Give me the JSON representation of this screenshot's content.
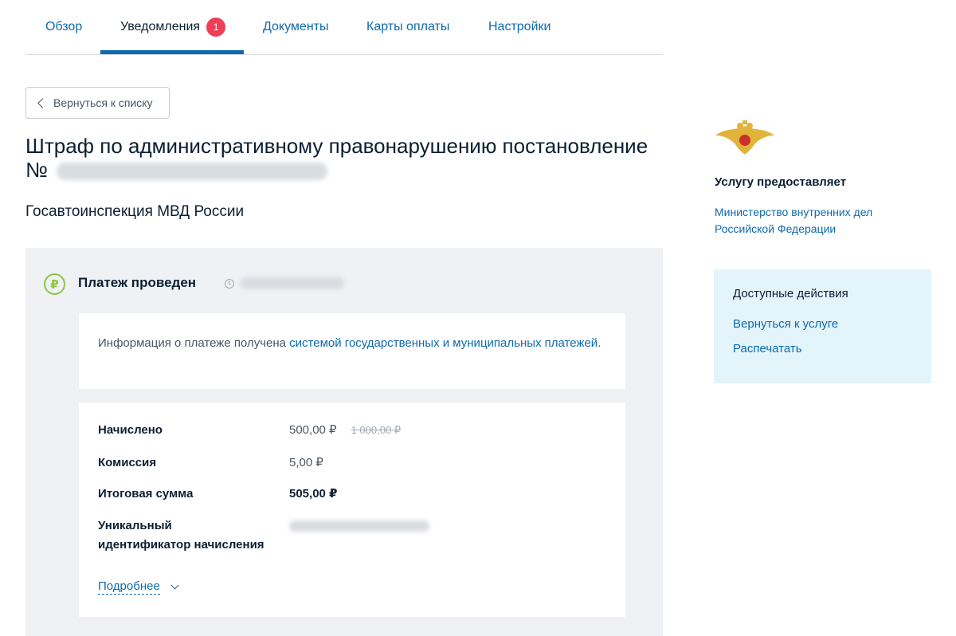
{
  "tabs": [
    {
      "label": "Обзор"
    },
    {
      "label": "Уведомления",
      "badge": "1",
      "active": true
    },
    {
      "label": "Документы"
    },
    {
      "label": "Карты оплаты"
    },
    {
      "label": "Настройки"
    }
  ],
  "back_button": {
    "label": "Вернуться к списку"
  },
  "page": {
    "title": "Штраф по административному правонарушению постановление",
    "title_number_prefix": "№",
    "subtitle": "Госавтоинспекция МВД России"
  },
  "payment": {
    "status": "Платеж проведен",
    "info_text": "Информация о платеже получена ",
    "info_link": "системой государственных и муниципальных платежей",
    "info_suffix": ".",
    "rows": [
      {
        "label": "Начислено",
        "value": "500,00 ₽",
        "old_value": "1 000,00 ₽"
      },
      {
        "label": "Комиссия",
        "value": "5,00 ₽"
      },
      {
        "label": "Итоговая сумма",
        "value": "505,00 ₽"
      },
      {
        "label_line1": "Уникальный",
        "label_line2": "идентификатор начисления"
      }
    ],
    "more_label": "Подробнее"
  },
  "provider": {
    "title": "Услугу предоставляет",
    "link": "Министерство внутренних дел Российской Федерации"
  },
  "actions": {
    "title": "Доступные действия",
    "items": [
      {
        "label": "Вернуться к услуге"
      },
      {
        "label": "Распечатать"
      }
    ]
  },
  "colors": {
    "accent": "#0d6aad",
    "badge": "#ee3f58",
    "success": "#8dc73f",
    "panel_bg": "#eff1f4",
    "actions_bg": "#e3f4fb"
  },
  "icons": {
    "back": "chevron-left-icon",
    "status": "ruble-icon",
    "time": "clock-icon",
    "more": "chevron-down-icon",
    "provider": "emblem-icon"
  }
}
